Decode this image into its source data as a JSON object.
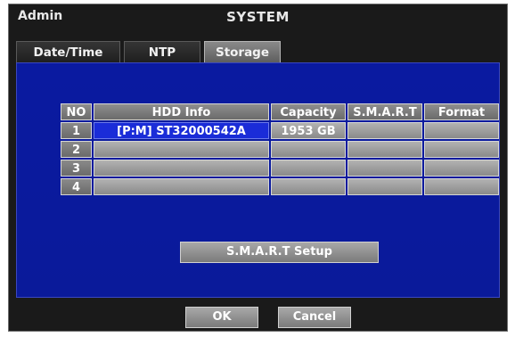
{
  "header": {
    "user": "Admin",
    "title": "SYSTEM"
  },
  "tabs": [
    {
      "label": "Date/Time",
      "active": false
    },
    {
      "label": "NTP",
      "active": false
    },
    {
      "label": "Storage",
      "active": true
    }
  ],
  "table": {
    "columns": [
      "NO",
      "HDD Info",
      "Capacity",
      "S.M.A.R.T",
      "Format"
    ],
    "rows": [
      {
        "no": "1",
        "hdd_info": "[P:M] ST32000542A",
        "capacity": "1953 GB",
        "smart": "",
        "format": ""
      },
      {
        "no": "2",
        "hdd_info": "",
        "capacity": "",
        "smart": "",
        "format": ""
      },
      {
        "no": "3",
        "hdd_info": "",
        "capacity": "",
        "smart": "",
        "format": ""
      },
      {
        "no": "4",
        "hdd_info": "",
        "capacity": "",
        "smart": "",
        "format": ""
      }
    ]
  },
  "buttons": {
    "smart_setup": "S.M.A.R.T Setup",
    "ok": "OK",
    "cancel": "Cancel"
  },
  "colors": {
    "panel": "#0a1aa0",
    "selected_cell": "#1a2cd8",
    "cell": "#9e9e9e",
    "window_bg": "#1a1a1a"
  }
}
